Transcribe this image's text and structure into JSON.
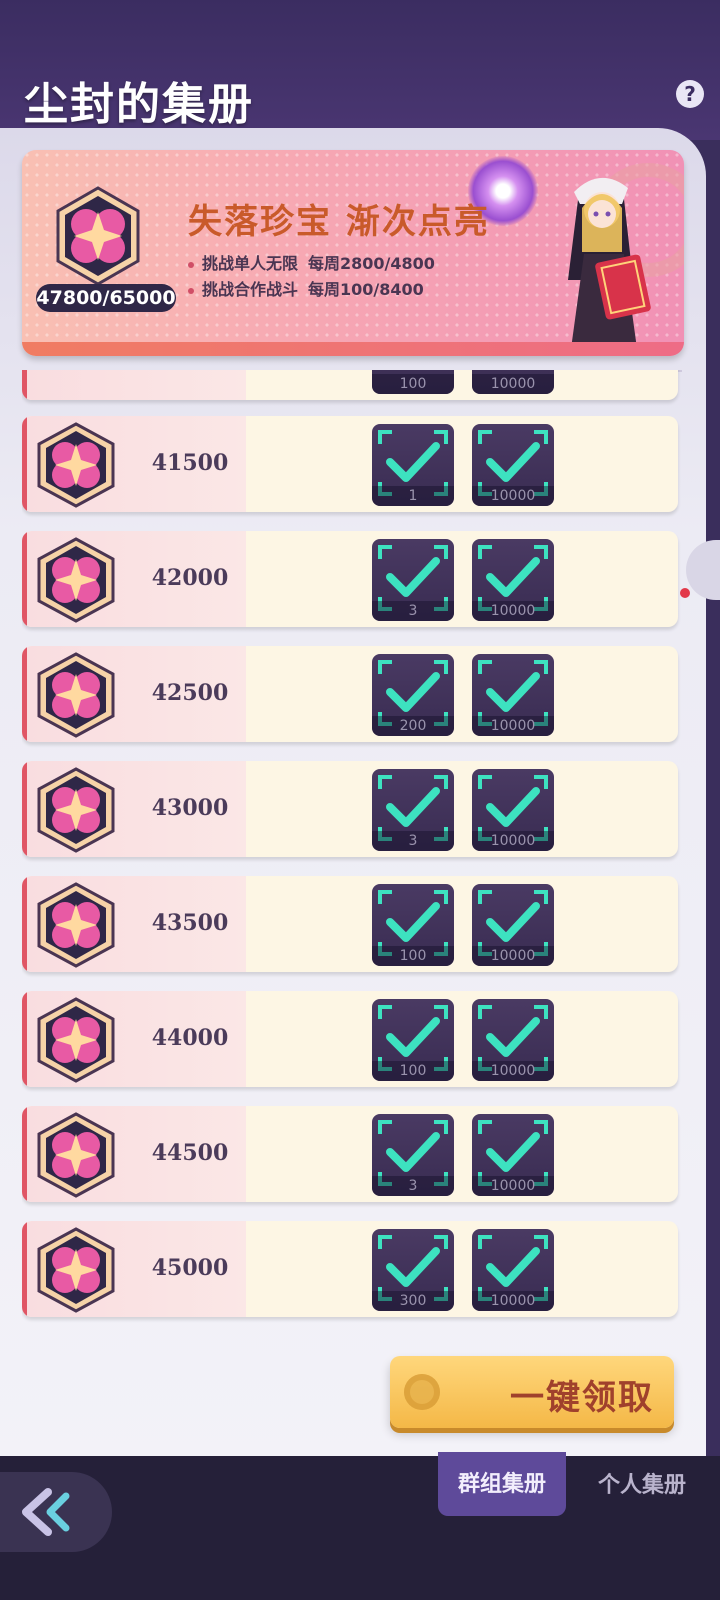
{
  "page": {
    "title": "尘封的集册",
    "help_icon": "?"
  },
  "banner": {
    "progress": "47800/65000",
    "headline": "失落珍宝 渐次点亮",
    "lines": [
      {
        "label": "挑战单人无限",
        "value": "每周2800/4800"
      },
      {
        "label": "挑战合作战斗",
        "value": "每周100/8400"
      }
    ]
  },
  "partial_row": {
    "q1": "100",
    "q2": "10000"
  },
  "milestones": [
    {
      "score": "41500",
      "rewards": [
        {
          "qty": "1",
          "claimed": true
        },
        {
          "qty": "10000",
          "claimed": true
        }
      ]
    },
    {
      "score": "42000",
      "rewards": [
        {
          "qty": "3",
          "claimed": true
        },
        {
          "qty": "10000",
          "claimed": true
        }
      ]
    },
    {
      "score": "42500",
      "rewards": [
        {
          "qty": "200",
          "claimed": true
        },
        {
          "qty": "10000",
          "claimed": true
        }
      ]
    },
    {
      "score": "43000",
      "rewards": [
        {
          "qty": "3",
          "claimed": true
        },
        {
          "qty": "10000",
          "claimed": true
        }
      ]
    },
    {
      "score": "43500",
      "rewards": [
        {
          "qty": "100",
          "claimed": true
        },
        {
          "qty": "10000",
          "claimed": true
        }
      ]
    },
    {
      "score": "44000",
      "rewards": [
        {
          "qty": "100",
          "claimed": true
        },
        {
          "qty": "10000",
          "claimed": true
        }
      ]
    },
    {
      "score": "44500",
      "rewards": [
        {
          "qty": "3",
          "claimed": true
        },
        {
          "qty": "10000",
          "claimed": true
        }
      ]
    },
    {
      "score": "45000",
      "rewards": [
        {
          "qty": "300",
          "claimed": true
        },
        {
          "qty": "10000",
          "claimed": true
        }
      ]
    }
  ],
  "claim_button": {
    "label": "一键领取"
  },
  "tabs": [
    {
      "label": "群组集册",
      "active": true
    },
    {
      "label": "个人集册",
      "active": false
    }
  ],
  "colors": {
    "accent_check": "#3de2c0",
    "row_accent": "#e05565",
    "claim_gold": "#f4b847",
    "tab_active": "#5e4a9a"
  }
}
